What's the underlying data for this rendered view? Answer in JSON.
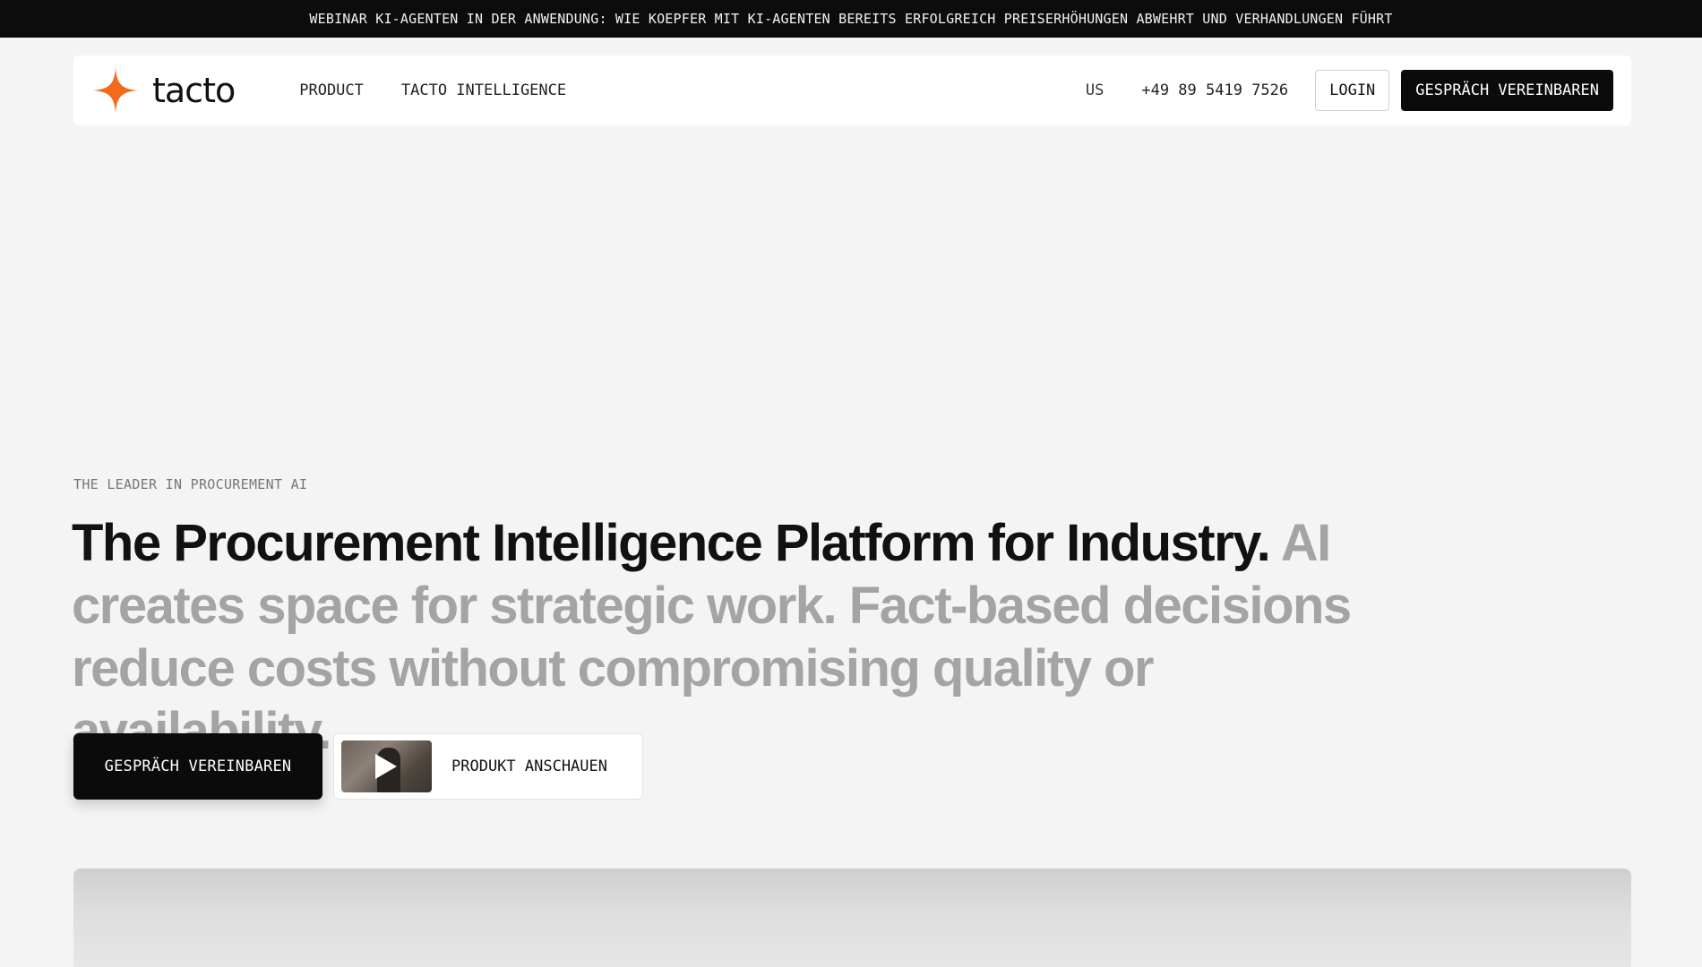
{
  "announcement": {
    "text": "WEBINAR KI-AGENTEN IN DER ANWENDUNG: WIE KOEPFER MIT KI-AGENTEN BEREITS ERFOLGREICH PREISERHÖHUNGEN ABWEHRT UND VERHANDLUNGEN FÜHRT"
  },
  "nav": {
    "logo_text": "tacto",
    "logo_icon": "four-point-star-icon",
    "links": [
      {
        "label": "PRODUCT"
      },
      {
        "label": "TACTO INTELLIGENCE"
      }
    ],
    "locale": "US",
    "phone": "+49 89 5419 7526",
    "login_label": "LOGIN",
    "cta_label": "GESPRÄCH VEREINBAREN"
  },
  "hero": {
    "eyebrow": "THE LEADER IN PROCUREMENT AI",
    "headline_strong": "The Procurement Intelligence Platform for Industry.",
    "headline_muted": "AI creates space for strategic work. Fact-based decisions reduce costs without compromising quality or availability.",
    "primary_button": "GESPRÄCH VEREINBAREN",
    "video_button": "PRODUKT ANSCHAUEN",
    "video_icon": "play-icon"
  },
  "colors": {
    "accent": "#f26b1d",
    "dark": "#0b0b0b",
    "muted_text": "#a4a4a4",
    "background": "#f4f4f4"
  }
}
